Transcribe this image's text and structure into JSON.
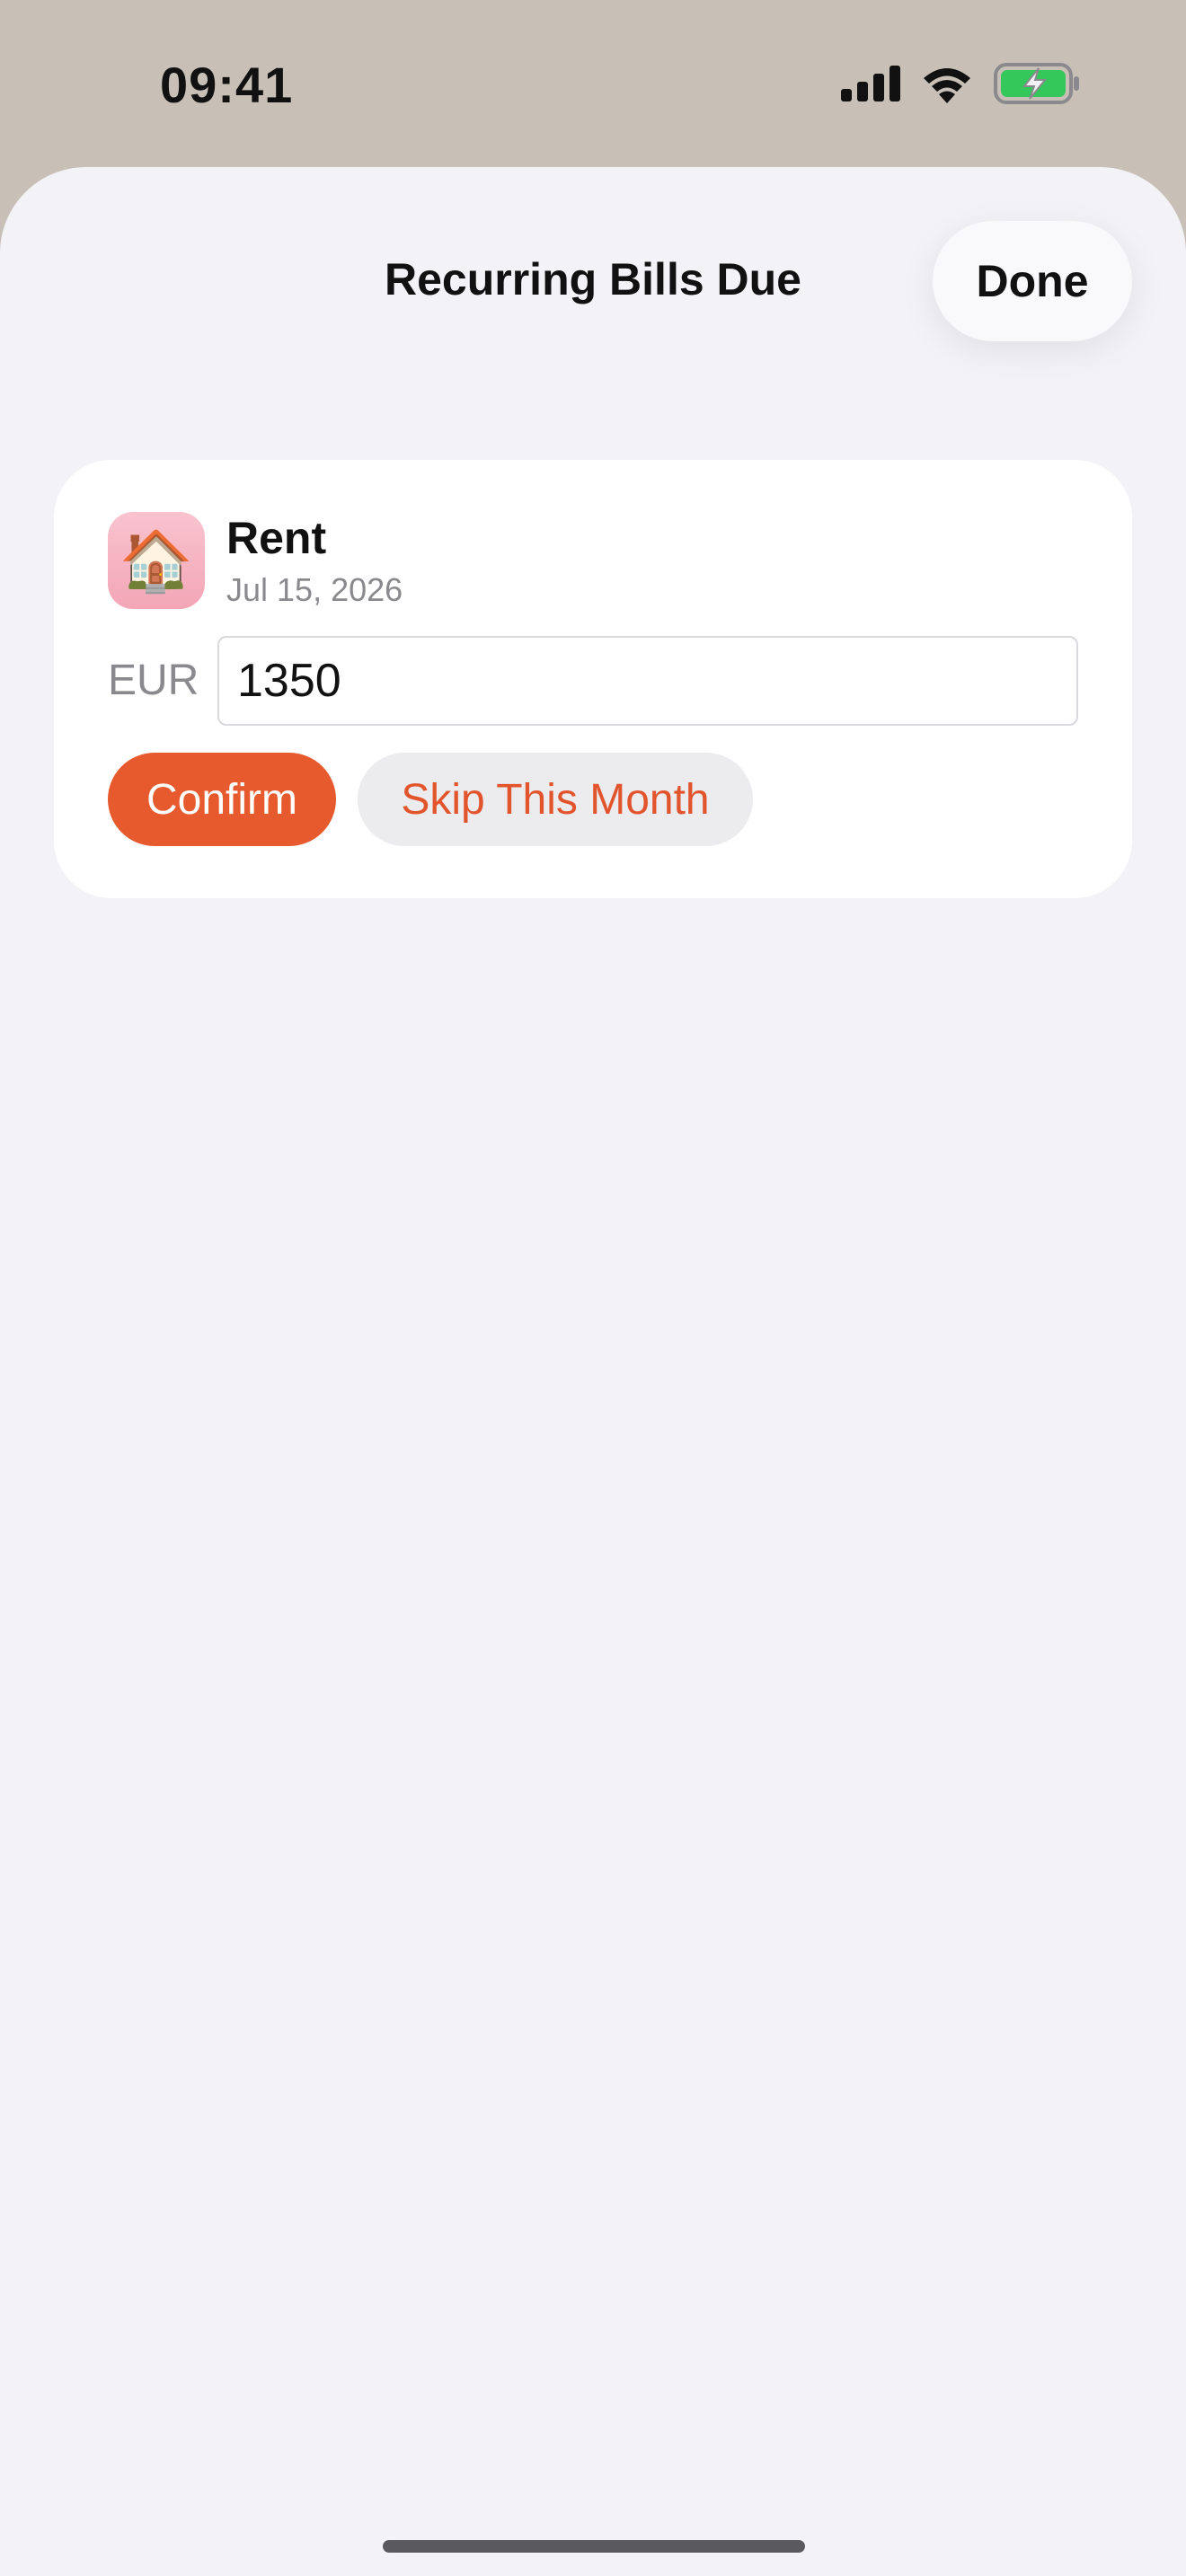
{
  "status_bar": {
    "time": "09:41",
    "icons": [
      "cellular-signal-icon",
      "wifi-icon",
      "battery-charging-icon"
    ],
    "battery_color": "#34C759"
  },
  "sheet": {
    "title": "Recurring Bills Due",
    "done_label": "Done"
  },
  "bill": {
    "icon": "house-icon",
    "icon_glyph": "🏠",
    "name": "Rent",
    "date": "Jul 15, 2026",
    "currency": "EUR",
    "amount": "1350",
    "confirm_label": "Confirm",
    "skip_label": "Skip This Month"
  },
  "colors": {
    "accent": "#E65A2E",
    "sheet_background": "#F2F2F7",
    "backdrop": "#C8C0B6"
  }
}
